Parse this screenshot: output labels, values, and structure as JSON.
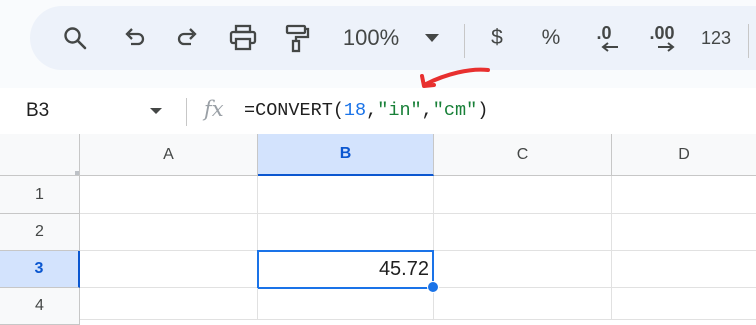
{
  "toolbar": {
    "zoom": "100%",
    "currency_label": "$",
    "percent_label": "%",
    "decrease_decimal_label": ".0",
    "increase_decimal_label": ".00",
    "number_format_label": "123",
    "icons": [
      "search-icon",
      "undo-icon",
      "redo-icon",
      "print-icon",
      "paint-format-icon",
      "zoom-dropdown-icon"
    ]
  },
  "formula_bar": {
    "name_box": "B3",
    "fx_label": "fx",
    "formula": {
      "prefix": "=CONVERT(",
      "number": "18",
      "comma1": ",",
      "from_unit": "\"in\"",
      "comma2": ",",
      "to_unit": "\"cm\"",
      "suffix": ")"
    }
  },
  "grid": {
    "columns": [
      "A",
      "B",
      "C",
      "D"
    ],
    "rows": [
      "1",
      "2",
      "3",
      "4"
    ],
    "selected_column": "B",
    "selected_row": "3",
    "cells": {
      "B3": "45.72"
    }
  },
  "colors": {
    "accent": "#1a73e8",
    "header_selected_bg": "#d3e3fd",
    "formula_number": "#1a73e8",
    "formula_string": "#188038",
    "annotation_arrow": "#e8302f"
  }
}
